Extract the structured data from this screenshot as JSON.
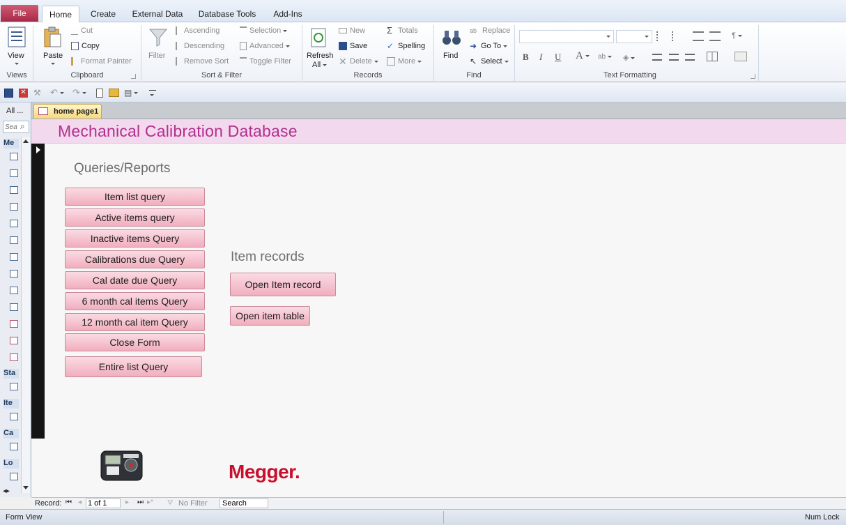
{
  "ribbon_tabs": {
    "file": "File",
    "home": "Home",
    "create": "Create",
    "external_data": "External Data",
    "database_tools": "Database Tools",
    "add_ins": "Add-Ins"
  },
  "ribbon": {
    "views": {
      "view": "View",
      "label": "Views"
    },
    "clipboard": {
      "paste": "Paste",
      "cut": "Cut",
      "copy": "Copy",
      "format_painter": "Format Painter",
      "label": "Clipboard"
    },
    "sort_filter": {
      "filter": "Filter",
      "ascending": "Ascending",
      "descending": "Descending",
      "remove_sort": "Remove Sort",
      "selection": "Selection",
      "advanced": "Advanced",
      "toggle_filter": "Toggle Filter",
      "label": "Sort & Filter"
    },
    "records": {
      "refresh": "Refresh",
      "refresh_all": "All",
      "new": "New",
      "save": "Save",
      "delete": "Delete",
      "totals": "Totals",
      "spelling": "Spelling",
      "more": "More",
      "label": "Records"
    },
    "find": {
      "find": "Find",
      "replace": "Replace",
      "go_to": "Go To",
      "select": "Select",
      "label": "Find"
    },
    "text_formatting": {
      "bold": "B",
      "italic": "I",
      "underline": "U",
      "font_color": "A",
      "label": "Text Formatting"
    }
  },
  "nav_pane": {
    "all_label": "All ...",
    "search_placeholder": "Sea",
    "groups": [
      "Me",
      "Sta",
      "Ite",
      "Ca",
      "Lo"
    ]
  },
  "document_tab": "home page1",
  "form": {
    "title": "Mechanical Calibration Database",
    "queries_title": "Queries/Reports",
    "query_buttons": [
      "Item list query",
      "Active items query",
      "Inactive items Query",
      "Calibrations due Query",
      "Cal date due Query",
      "6 month cal items Query",
      "12 month cal item Query",
      "Close Form",
      "Entire list Query"
    ],
    "records_title": "Item records",
    "open_item_record": "Open Item record",
    "open_item_table": "Open item table",
    "logo_text": "Megger",
    "logo_dot": "."
  },
  "record_nav": {
    "record_label": "Record:",
    "position": "1 of 1",
    "filter": "No Filter",
    "search": "Search"
  },
  "status": {
    "left": "Form View",
    "right": "Num Lock"
  },
  "colors": {
    "accent": "#b32f8e",
    "button": "#f1aebe",
    "file_tab": "#a52a48"
  }
}
